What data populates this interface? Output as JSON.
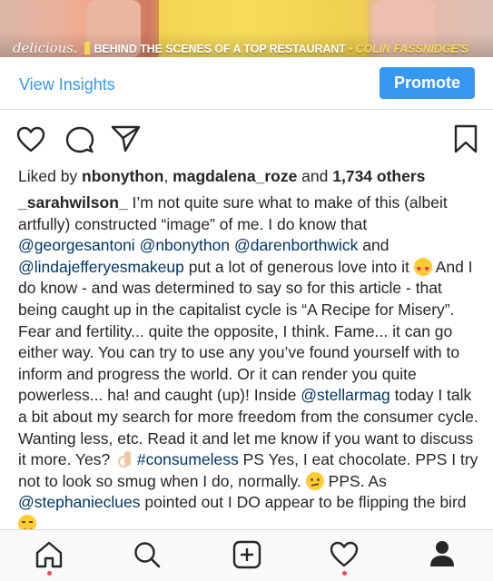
{
  "photo": {
    "brand": "delicious.",
    "headline": "BEHIND THE SCENES OF A TOP RESTAURANT",
    "author": "COLIN FASSNIDGE'S"
  },
  "insights_bar": {
    "view_insights_label": "View Insights",
    "promote_label": "Promote"
  },
  "actions": {
    "icons": [
      "heart-icon",
      "comment-icon",
      "share-icon",
      "bookmark-icon"
    ]
  },
  "likes": {
    "prefix": "Liked by ",
    "user1": "nbonython",
    "comma": ", ",
    "user2": "magdalena_roze",
    "and": " and ",
    "others": "1,734 others"
  },
  "caption": {
    "username": "_sarahwilson_",
    "t1": " I’m not quite sure what to make of this (albeit artfully) constructed “image” of me. I do know that ",
    "m1": "@georgesantoni",
    "s1": " ",
    "m2": "@nbonython",
    "s2": " ",
    "m3": "@darenborthwick",
    "t2": " and ",
    "m4": "@lindajefferyesmakeup",
    "t3": " put a lot of generous love into it ",
    "t4": " And I do know - and was determined to say so for this article - that being caught up in the capitalist cycle is “A Recipe for Misery”. Fear and fertility... quite the opposite, I think. Fame... it can go either way. You can try to use any you’ve found yourself with to inform and progress the world. Or it can render you quite powerless... ha! and caught (up)! Inside ",
    "m5": "@stellarmag",
    "t5": " today I talk a bit about my search for more freedom from the consumer cycle. Wanting less, etc. Read it and let me know if you want to discuss it more.  Yes? ",
    "s3": " ",
    "hashtag": "#consumeless",
    "t6": " PS Yes, I eat chocolate. PPS I try not to look so smug when I do, normally. ",
    "t7": " PPS. As ",
    "m6": "@stephanieclues",
    "t8": " pointed out I DO appear to be flipping the bird ",
    "emojis": [
      "heart-eyes-emoji",
      "ok-hand-emoji",
      "confused-emoji",
      "smirk-emoji"
    ]
  },
  "bottom_nav": {
    "icons": [
      "home-icon",
      "search-icon",
      "add-post-icon",
      "activity-heart-icon",
      "profile-icon"
    ]
  },
  "colors": {
    "accent": "#3897f0",
    "mention": "#003569",
    "notification_dot": "#ed4956",
    "text": "#262626"
  }
}
